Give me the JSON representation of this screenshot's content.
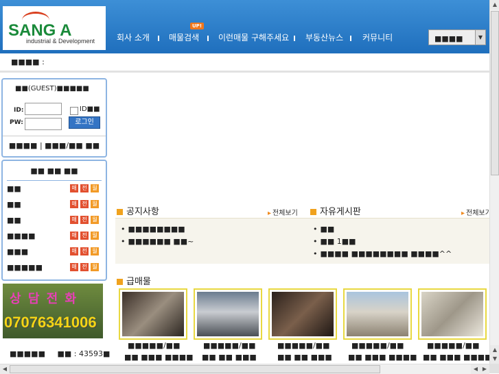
{
  "logo": {
    "name": "SANG A",
    "sub": "industrial & Development"
  },
  "nav": {
    "items": [
      "회사 소개",
      "매물검색",
      "이런매물 구해주세요",
      "부동산뉴스",
      "커뮤니티"
    ],
    "badge": "UP!"
  },
  "lang_select": {
    "value": "■■■■"
  },
  "subbar": {
    "text": "■■■■ :"
  },
  "login": {
    "title": "■■(GUEST)■■■■■",
    "id_label": "ID:",
    "pw_label": "PW:",
    "remember": "ID■■",
    "button": "로그인",
    "links": "■■■■ | ■■■/■■ ■■"
  },
  "category": {
    "title": "■■ ■■ ■■",
    "rows": [
      "■■",
      "■■",
      "■■",
      "■■■■",
      "■■■",
      "■■■■■"
    ],
    "tags": [
      "매",
      "전",
      "월"
    ]
  },
  "phone": {
    "label": "상 담 전 화",
    "number": "07076341006"
  },
  "footer_left": {
    "text": "■■■■■",
    "code": "■■ : 43593■"
  },
  "notice": {
    "title": "공지사항",
    "more": "전체보기",
    "items": [
      "■■■■■■■■",
      "■■■■■■ ■■~"
    ]
  },
  "board": {
    "title": "자유게시판",
    "more": "전체보기",
    "items": [
      "■■",
      "■■ 1■■",
      "■■■■ ■■■■■■■■ ■■■■^^"
    ]
  },
  "urgent": {
    "title": "급매물",
    "listings": [
      {
        "line1": "■■■■■/■■",
        "line2": "■■ ■■■ ■■■■"
      },
      {
        "line1": "■■■■■/■■",
        "line2": "■■ ■■ ■■■"
      },
      {
        "line1": "■■■■■/■■",
        "line2": "■■ ■■ ■■■"
      },
      {
        "line1": "■■■■■/■■",
        "line2": "■■ ■■■ ■■■■"
      },
      {
        "line1": "■■■■■/■■",
        "line2": "■■ ■■■ ■■■■"
      }
    ]
  },
  "colors": {
    "header": "#2a7bc6",
    "accent": "#f0a21e",
    "card_border": "#e8d840",
    "tag_red": "#e2502f",
    "tag_orange": "#f29a26"
  }
}
